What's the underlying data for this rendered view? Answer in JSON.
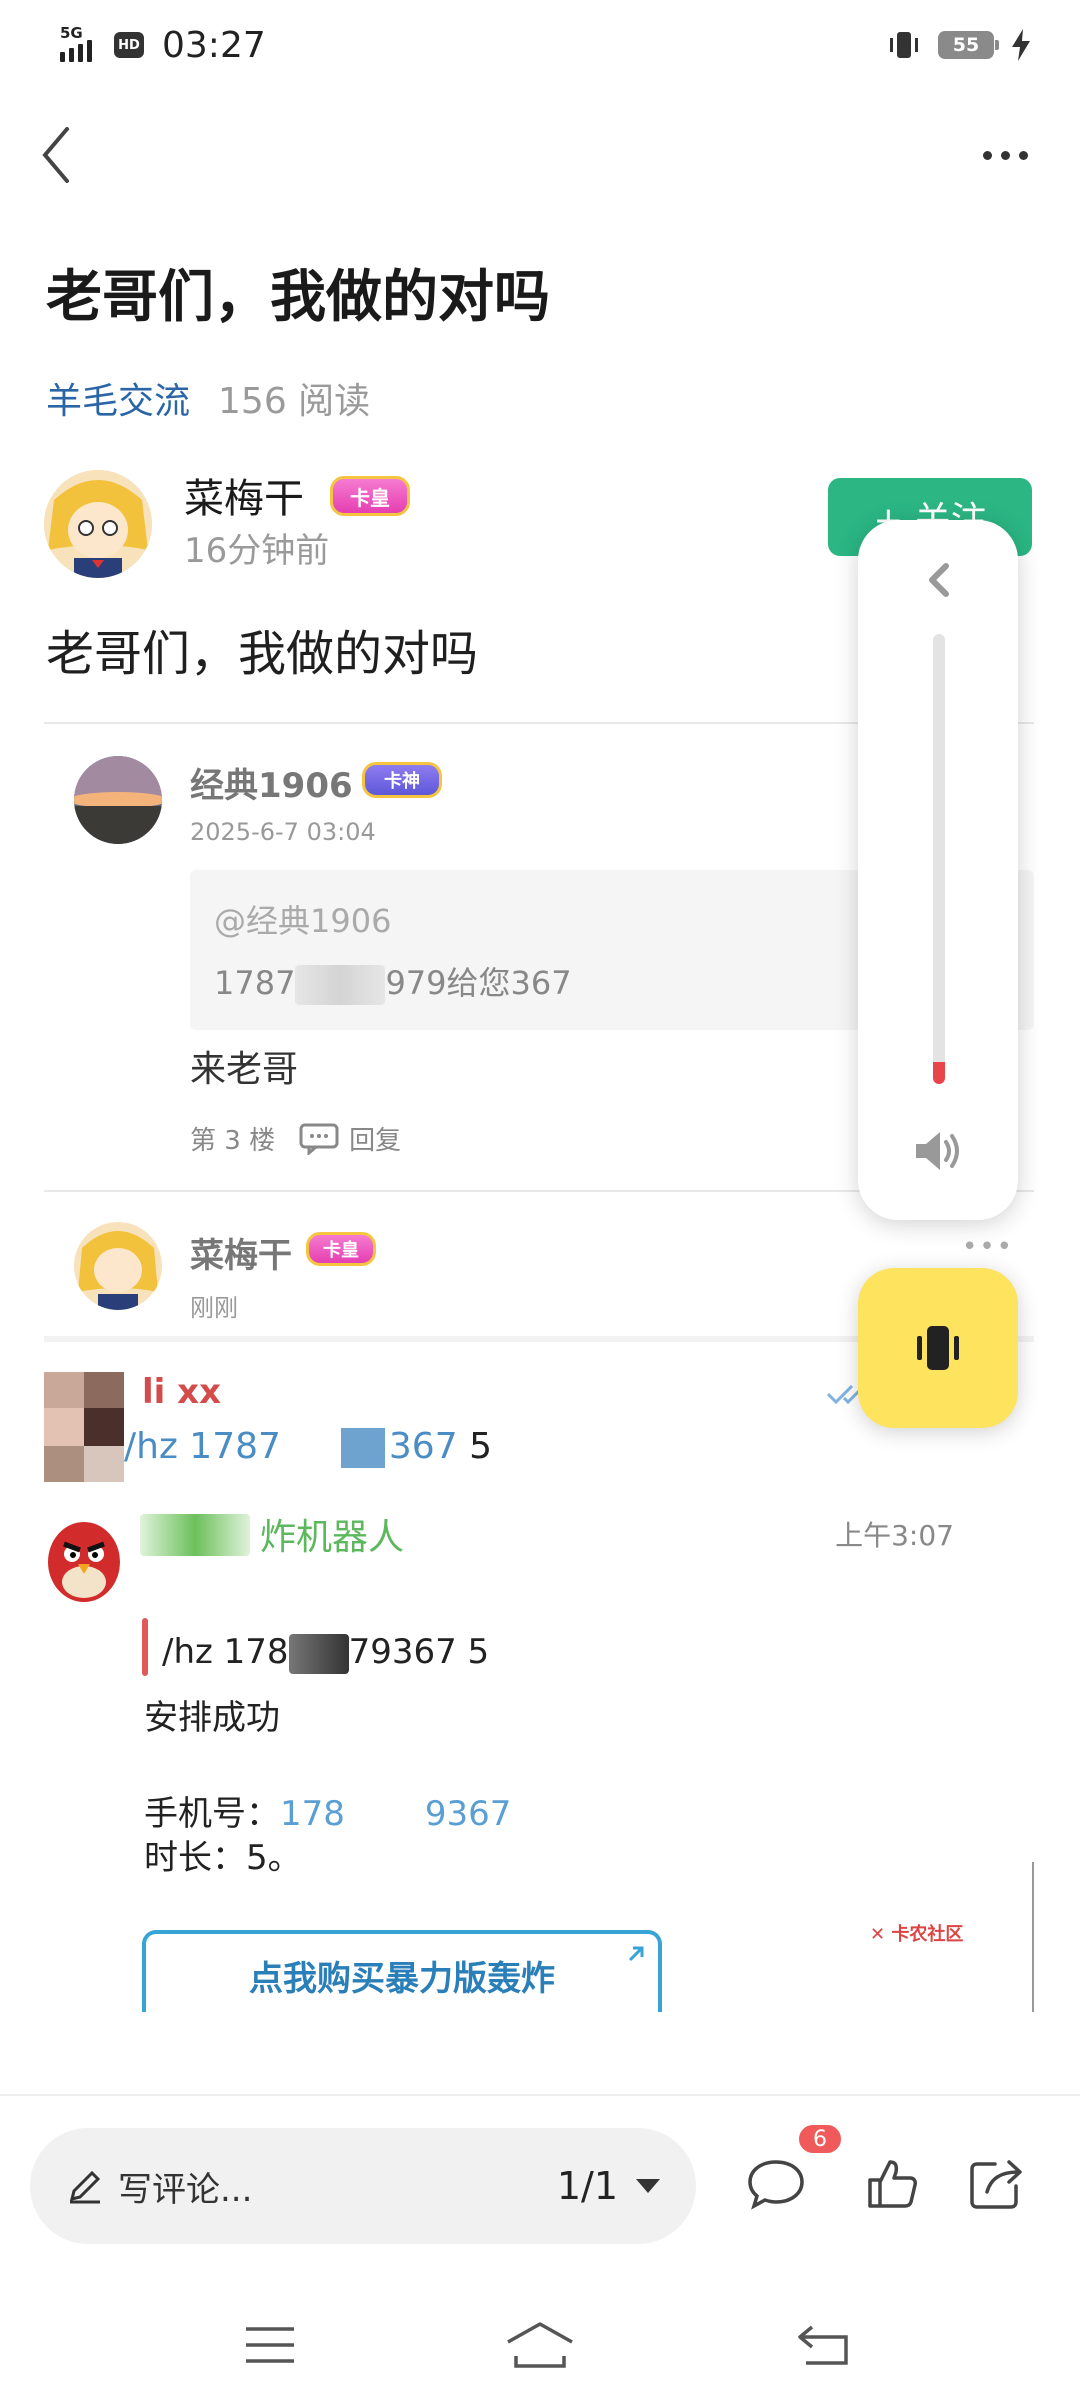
{
  "status_bar": {
    "network": "5G",
    "hd": "HD",
    "time": "03:27",
    "battery": "55"
  },
  "post": {
    "title": "老哥们，我做的对吗",
    "category": "羊毛交流",
    "views": "156 阅读",
    "author": {
      "name": "菜梅干",
      "badge": "卡皇",
      "time": "16分钟前"
    },
    "follow_label": "+ 关注",
    "body": "老哥们，我做的对吗"
  },
  "screenshot": {
    "comment1": {
      "name": "经典1906",
      "badge": "卡神",
      "date": "2025-6-7 03:04",
      "quote_at": "@经典1906",
      "quote_text_a": "1787",
      "quote_text_b": "979给您367",
      "reply": "来老哥",
      "floor": "第 3 楼",
      "reply_label": "回复"
    },
    "comment2": {
      "name": "菜梅干",
      "badge": "卡皇",
      "date": "刚刚",
      "more": "•••"
    },
    "chat": {
      "sender": "li xx",
      "msg_a": "/hz 1787",
      "msg_b": "367",
      "msg_c": " 5",
      "bot_name": "炸机器人",
      "bot_time": "上午3:07",
      "quoted_a": "/hz 178",
      "quoted_b": "79367 5",
      "line1": "安排成功",
      "phone_label": "手机号：",
      "phone_a": "178",
      "phone_b": "9367",
      "duration": "时长：5。",
      "buy_button": "点我购买暴力版轰炸",
      "watermark": "卡农社区"
    }
  },
  "bottom_bar": {
    "comment_placeholder": "写评论...",
    "page_indicator": "1/1",
    "comment_count": "6"
  },
  "colors": {
    "accent_green": "#2bb684",
    "category_blue": "#2a66a6",
    "badge_red": "#f05a5a",
    "vibrate_yellow": "#fde35e"
  },
  "volume": {
    "level": 0.05
  }
}
